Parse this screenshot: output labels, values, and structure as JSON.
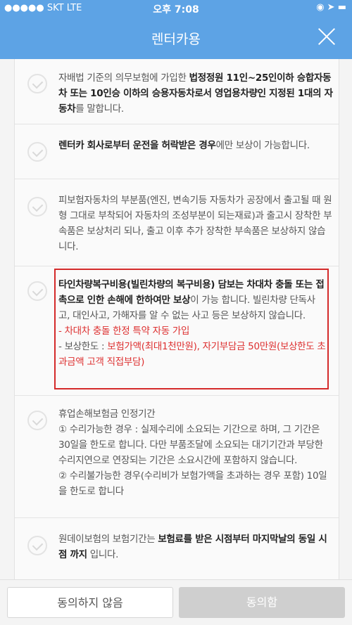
{
  "status_bar": {
    "carrier": "●●●●● SKT  LTE",
    "time": "오후 7:08",
    "right": "◉ ➤ ▬"
  },
  "header": {
    "title": "렌터카용",
    "close_icon": "close-icon"
  },
  "items": [
    {
      "parts": [
        {
          "t": "자배법 기준의 의무보험에 가입한 "
        },
        {
          "t": "법정정원 11인~25인이하 승합자동차 또는 10인승 이하의 승용자동차로서 영업용차량인 지정된 1대의 자동차",
          "b": true
        },
        {
          "t": "를 말합니다."
        }
      ]
    },
    {
      "parts": [
        {
          "t": "렌터카 회사로부터 운전을 허락받은 경우",
          "b": true
        },
        {
          "t": "에만 보상이 가능합니다."
        }
      ]
    },
    {
      "parts": [
        {
          "t": "피보험자동차의 부분품(엔진, 변속기등 자동차가 공장에서 출고될 때 원형 그대로 부착되어 자동차의 조성부분이 되는재료)과 출고시 장착한 부속품은 보상처리 되나, 출고 이후 추가 장착한 부속품은 보상하지 않습니다."
        }
      ]
    },
    {
      "parts": [
        {
          "t": "타인차량복구비용(빌린차량의 복구비용) 담보는 차대차 충돌 또는 접촉으로 인한 손해에 한하여만 보상",
          "b": true
        },
        {
          "t": "이 가능 합니다. 빌린차량 단독사고, 대인사고, 가해자를 알 수 없는 사고 등은 보상하지 않습니다."
        }
      ],
      "line2": [
        {
          "t": "- 차대차 충돌 한정 특약 자동 가입",
          "r": true
        }
      ],
      "line3": [
        {
          "t": "- 보상한도 : "
        },
        {
          "t": "보험가액(최대1천만원), 자기부담금 50만원(보상한도 초과금액 고객 직접부담)",
          "r": true
        }
      ]
    },
    {
      "parts": [
        {
          "t": "휴업손해보험금 인정기간"
        }
      ],
      "line2": [
        {
          "t": "① 수리가능한 경우 : 실제수리에 소요되는 기간으로 하며, 그 기간은 30일을 한도로 합니다. 다만 부품조달에 소요되는 대기기간과 부당한 수리지연으로 연장되는 기간은 소요시간에 포함하지 않습니다."
        }
      ],
      "line3": [
        {
          "t": "② 수리불가능한 경우(수리비가 보험가액을 초과하는 경우 포함) 10일을 한도로 합니다"
        }
      ]
    },
    {
      "parts": [
        {
          "t": "원데이보험의 보험기간는 "
        },
        {
          "t": "보험료를 받은 시점부터 마지막날의 동일 시점 까지",
          "b": true
        },
        {
          "t": " 입니다."
        }
      ]
    }
  ],
  "footer": {
    "disagree_label": "동의하지 않음",
    "agree_label": "동의함"
  }
}
